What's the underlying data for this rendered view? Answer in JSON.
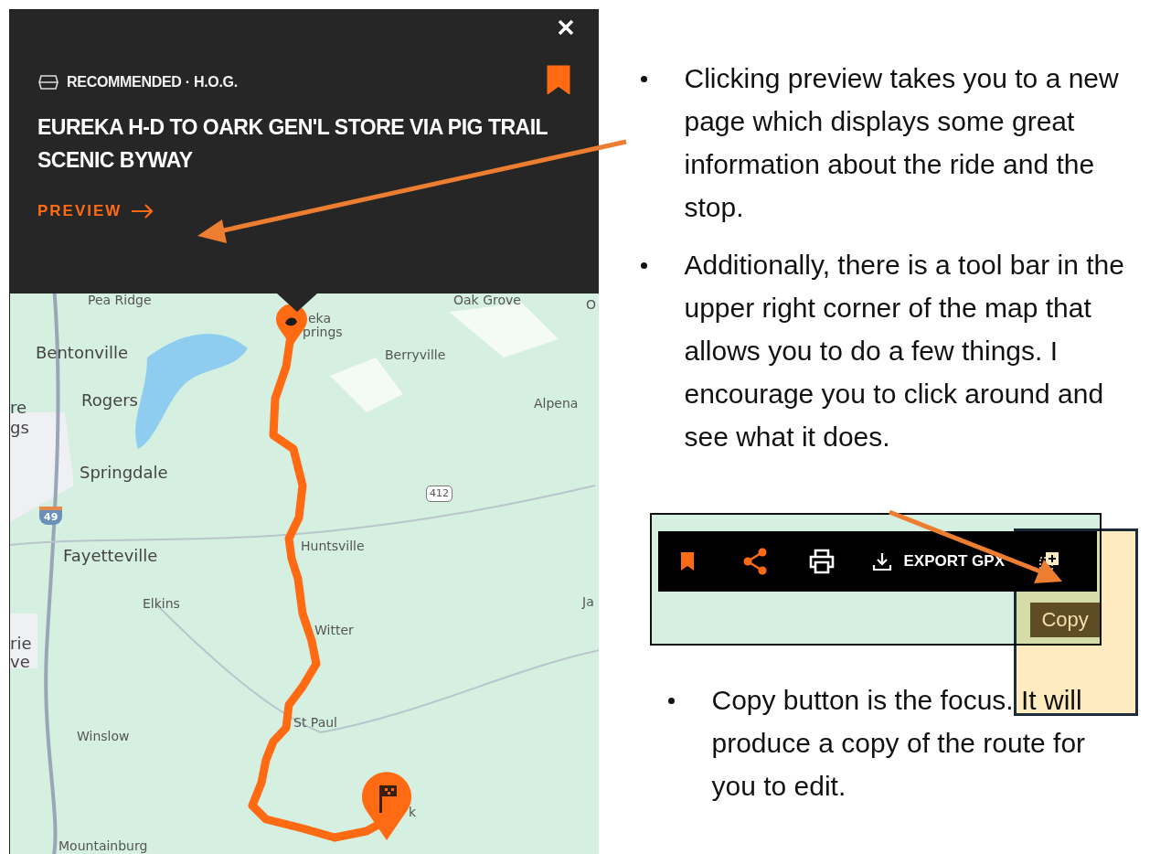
{
  "popup": {
    "category": "RECOMMENDED · H.O.G.",
    "bookmarked": true,
    "title": "EUREKA H-D TO OARK GEN'L STORE VIA PIG TRAIL SCENIC BYWAY",
    "link": "PREVIEW"
  },
  "map": {
    "labels": [
      {
        "text": "Pea Ridge",
        "kind": "town"
      },
      {
        "text": "Oak Grove",
        "kind": "town"
      },
      {
        "text": "O",
        "kind": "edge"
      },
      {
        "text": "eka",
        "kind": "town"
      },
      {
        "text": "prings",
        "kind": "town"
      },
      {
        "text": "Bentonville",
        "kind": "city"
      },
      {
        "text": "Berryville",
        "kind": "town"
      },
      {
        "text": "re",
        "kind": "city"
      },
      {
        "text": "gs",
        "kind": "city"
      },
      {
        "text": "Rogers",
        "kind": "city"
      },
      {
        "text": "Alpena",
        "kind": "town"
      },
      {
        "text": "Springdale",
        "kind": "city"
      },
      {
        "text": "412",
        "kind": "shield"
      },
      {
        "text": "49",
        "kind": "interstate"
      },
      {
        "text": "Fayetteville",
        "kind": "city"
      },
      {
        "text": "Huntsville",
        "kind": "town"
      },
      {
        "text": "Elkins",
        "kind": "town"
      },
      {
        "text": "Ja",
        "kind": "edge"
      },
      {
        "text": "rie",
        "kind": "city"
      },
      {
        "text": "ve",
        "kind": "city"
      },
      {
        "text": "Witter",
        "kind": "town"
      },
      {
        "text": "St Paul",
        "kind": "town"
      },
      {
        "text": "Winslow",
        "kind": "town"
      },
      {
        "text": "k",
        "kind": "town"
      },
      {
        "text": "Mountainburg",
        "kind": "town"
      }
    ]
  },
  "notes": [
    "Clicking preview takes you to a new page which displays some great information about the ride and the stop.",
    "Additionally, there is a tool bar in the upper right corner of the map that allows you to do a few things. I encourage you to click around and see what it does."
  ],
  "toolbar": {
    "items": [
      {
        "kind": "bookmark"
      },
      {
        "kind": "share"
      },
      {
        "kind": "print"
      },
      {
        "kind": "export",
        "label": "EXPORT GPX"
      },
      {
        "kind": "copy"
      }
    ],
    "tooltip": "Copy"
  },
  "notes_after": [
    "Copy button is the focus. It will produce a copy of the route for you to edit."
  ]
}
